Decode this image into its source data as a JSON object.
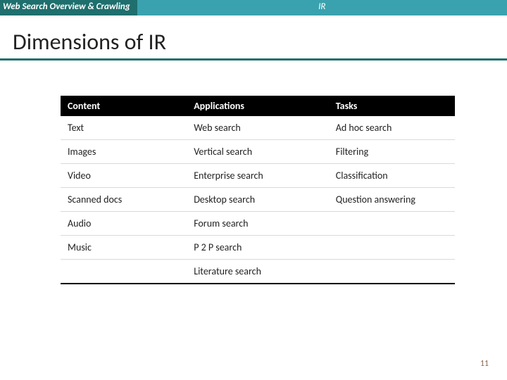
{
  "header": {
    "left": "Web Search Overview & Crawling",
    "right": "IR"
  },
  "title": "Dimensions of IR",
  "table": {
    "headers": [
      "Content",
      "Applications",
      "Tasks"
    ],
    "rows": [
      [
        "Text",
        "Web search",
        "Ad hoc search"
      ],
      [
        "Images",
        "Vertical search",
        "Filtering"
      ],
      [
        "Video",
        "Enterprise search",
        "Classification"
      ],
      [
        "Scanned docs",
        "Desktop search",
        "Question answering"
      ],
      [
        "Audio",
        "Forum search",
        ""
      ],
      [
        "Music",
        "P 2 P search",
        ""
      ],
      [
        "",
        "Literature search",
        ""
      ]
    ]
  },
  "page_number": "11"
}
